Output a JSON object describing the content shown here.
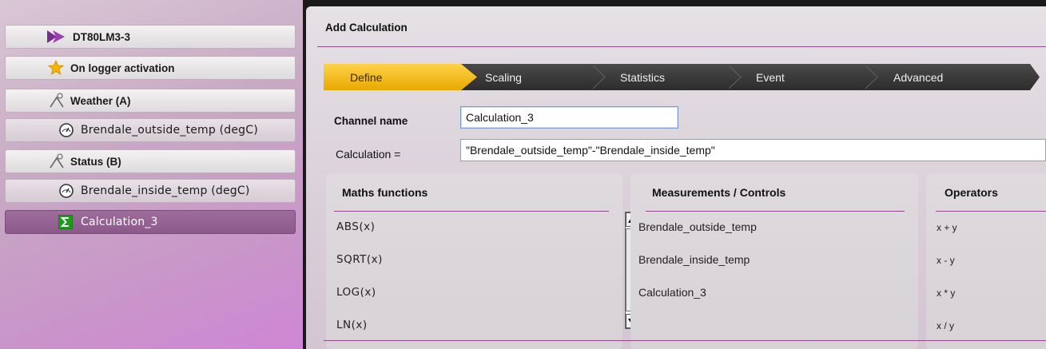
{
  "sidebar": {
    "items": [
      {
        "label": "DT80LM3-3",
        "icon": "play-logo-icon"
      },
      {
        "label": "On logger activation",
        "icon": "star-icon"
      },
      {
        "label": "Weather (A)",
        "icon": "wind-sensor-icon"
      },
      {
        "label": "Brendale_outside_temp (degC)",
        "icon": "gauge-icon"
      },
      {
        "label": "Status (B)",
        "icon": "wind-sensor-icon"
      },
      {
        "label": "Brendale_inside_temp (degC)",
        "icon": "gauge-icon"
      },
      {
        "label": "Calculation_3",
        "icon": "sigma-icon",
        "selected": true
      }
    ]
  },
  "main": {
    "title": "Add Calculation",
    "wizard": {
      "steps": [
        "Define",
        "Scaling",
        "Statistics",
        "Event",
        "Advanced"
      ],
      "active": "Define"
    },
    "form": {
      "channel_name_label": "Channel name",
      "channel_name_value": "Calculation_3",
      "calculation_label": "Calculation =",
      "calculation_value": "\"Brendale_outside_temp\"-\"Brendale_inside_temp\""
    },
    "maths": {
      "header": "Maths functions",
      "items": [
        "ABS(x)",
        "SQRT(x)",
        "LOG(x)",
        "LN(x)"
      ]
    },
    "measurements": {
      "header": "Measurements / Controls",
      "items": [
        "Brendale_outside_temp",
        "Brendale_inside_temp",
        "Calculation_3"
      ]
    },
    "operators": {
      "header": "Operators",
      "items": [
        "x + y",
        "x - y",
        "x * y",
        "x / y"
      ]
    }
  },
  "colors": {
    "accent_purple": "#8f4a8e",
    "step_active": "#f2b705",
    "step_inactive": "#3a3a3a"
  }
}
